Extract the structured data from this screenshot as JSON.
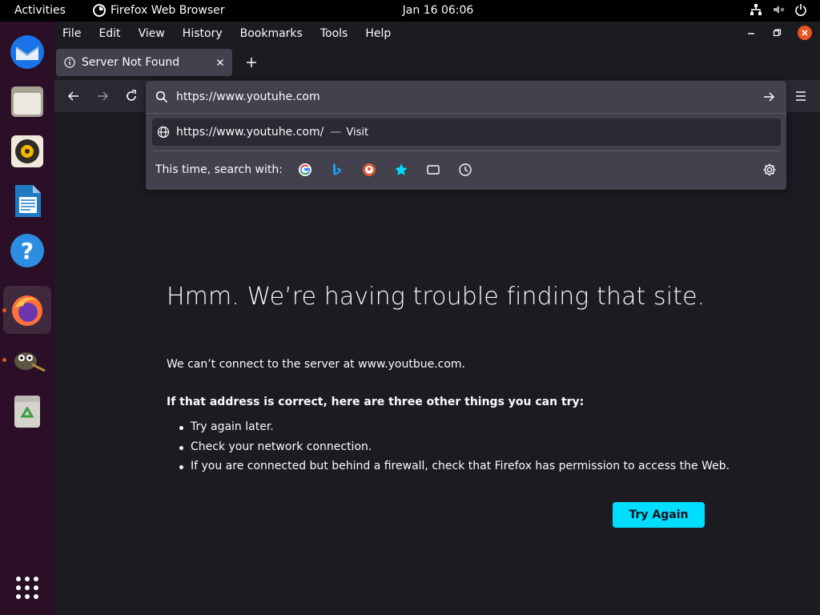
{
  "topbar": {
    "activities": "Activities",
    "app_name": "Firefox Web Browser",
    "clock": "Jan 16  06:06"
  },
  "dock": {
    "apps": [
      "thunderbird-icon",
      "files-icon",
      "rhythmbox-icon",
      "libreoffice-writer-icon",
      "help-icon",
      "firefox-icon",
      "gimp-icon",
      "trash-icon"
    ],
    "show_apps_icon": "app-grid-icon"
  },
  "menubar": {
    "file": "File",
    "edit": "Edit",
    "view": "View",
    "history": "History",
    "bookmarks": "Bookmarks",
    "tools": "Tools",
    "help": "Help"
  },
  "tab": {
    "title": "Server Not Found"
  },
  "urlbar": {
    "value": "https://www.youtuhe.com",
    "suggestion_url": "https://www.youtuhe.com/",
    "suggestion_sep": "—",
    "suggestion_action": "Visit",
    "search_with_label": "This time, search with:",
    "engines": [
      "google-icon",
      "bing-icon",
      "duckduckgo-icon",
      "bookmarks-star-icon",
      "tabs-icon",
      "history-icon"
    ]
  },
  "error": {
    "title": "Hmm. We’re having trouble finding that site.",
    "description": "We can’t connect to the server at www.youtbue.com.",
    "subhead": "If that address is correct, here are three other things you can try:",
    "tips": [
      "Try again later.",
      "Check your network connection.",
      "If you are connected but behind a firewall, check that Firefox has permission to access the Web."
    ],
    "button": "Try Again"
  },
  "colors": {
    "accent": "#00ddff",
    "ubuntu_orange": "#e95420",
    "page_bg": "#1c1b22",
    "toolbar_bg": "#2b2a33"
  }
}
